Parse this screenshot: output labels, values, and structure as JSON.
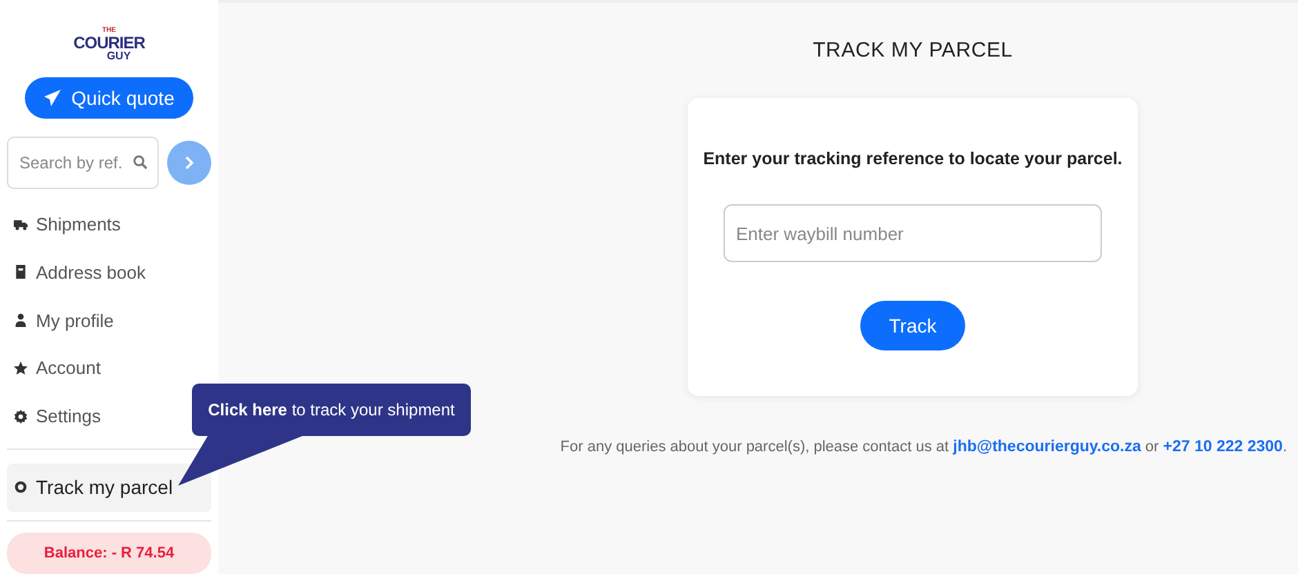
{
  "logo": {
    "top": "THE",
    "main": "COURIER",
    "bottom": "GUY"
  },
  "quick_quote": {
    "label": "Quick quote"
  },
  "search": {
    "placeholder": "Search by ref."
  },
  "sidebar": {
    "items": [
      {
        "label": "Shipments",
        "kind": "truck",
        "selected": false
      },
      {
        "label": "Address book",
        "kind": "book",
        "selected": false
      },
      {
        "label": "My profile",
        "kind": "person",
        "selected": false
      },
      {
        "label": "Account",
        "kind": "star",
        "selected": false
      },
      {
        "label": "Settings",
        "kind": "gear",
        "selected": false
      },
      {
        "label": "Track my parcel",
        "kind": "ring",
        "selected": true
      }
    ]
  },
  "balance": "Balance: - R 74.54",
  "tooltip": "**Click here** to track your shipment",
  "page_title": "TRACK MY PARCEL",
  "card": {
    "prompt": "Enter your tracking reference to locate your parcel.",
    "waybill_placeholder": "Enter waybill number",
    "button": "Track"
  },
  "contact": {
    "before": "For any queries about your parcel(s), please contact us at ",
    "email": "jhb@thecourierguy.co.za",
    "between": " or ",
    "phone": "+27 10 222 2300",
    "after": "."
  }
}
